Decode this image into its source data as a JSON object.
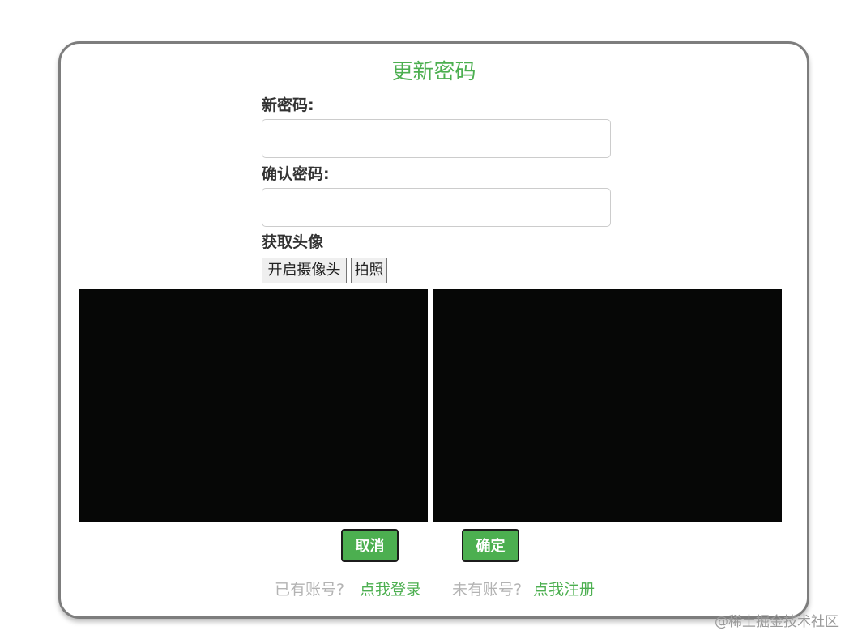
{
  "form": {
    "title": "更新密码",
    "new_password_label": "新密码:",
    "new_password_value": "",
    "confirm_password_label": "确认密码:",
    "confirm_password_value": "",
    "avatar_label": "获取头像"
  },
  "camera": {
    "open_label": "开启摄像头",
    "capture_label": "拍照"
  },
  "actions": {
    "cancel_label": "取消",
    "confirm_label": "确定"
  },
  "footer": {
    "has_account_text": "已有账号?",
    "login_link": "点我登录",
    "no_account_text": "未有账号?",
    "register_link": "点我注册"
  },
  "watermark": "@稀土掘金技术社区",
  "colors": {
    "accent": "#4caf50",
    "card_border": "#7d7d7d",
    "video_bg": "#060706"
  }
}
